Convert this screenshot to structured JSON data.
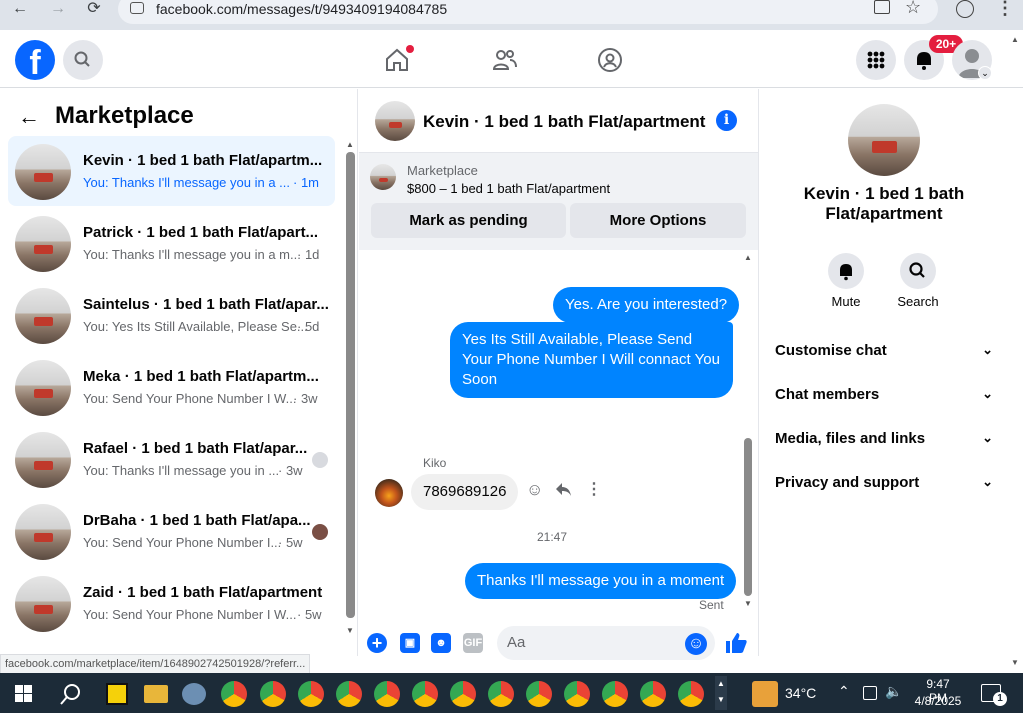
{
  "browser": {
    "url": "facebook.com/messages/t/9493409194084785"
  },
  "header": {
    "notifications_badge": "20+"
  },
  "sidebar": {
    "title": "Marketplace",
    "conversations": [
      {
        "name": "Kevin · 1 bed 1 bath Flat/apartm...",
        "preview": "You: Thanks I'll message you in a ...",
        "time": "· 1m"
      },
      {
        "name": "Patrick · 1 bed 1 bath Flat/apart...",
        "preview": "You: Thanks I'll message you in a m...",
        "time": "· 1d"
      },
      {
        "name": "Saintelus · 1 bed 1 bath Flat/apar...",
        "preview": "You: Yes Its Still Available, Please Se...",
        "time": "· 5d"
      },
      {
        "name": "Meka · 1 bed 1 bath Flat/apartm...",
        "preview": "You: Send Your Phone Number I W...",
        "time": "· 3w"
      },
      {
        "name": "Rafael · 1 bed 1 bath Flat/apar...",
        "preview": "You: Thanks I'll message you in ...",
        "time": "· 3w"
      },
      {
        "name": "DrBaha · 1 bed 1 bath Flat/apa...",
        "preview": "You: Send Your Phone Number I...",
        "time": "· 5w"
      },
      {
        "name": "Zaid · 1 bed 1 bath Flat/apartment",
        "preview": "You: Send Your Phone Number I W...",
        "time": "· 5w"
      }
    ],
    "status_url": "facebook.com/marketplace/item/1648902742501928/?referr..."
  },
  "chat": {
    "title": "Kevin · 1 bed 1 bath Flat/apartment",
    "listing_label": "Marketplace",
    "listing_desc": "$800 – 1 bed 1 bath Flat/apartment",
    "mark_pending": "Mark as pending",
    "more_options": "More Options",
    "messages": {
      "m1": "Yes. Are you interested?",
      "m2": "Yes Its Still Available, Please Send Your Phone Number I Will connact You Soon",
      "sender": "Kiko",
      "m3": "7869689126",
      "timestamp": "21:47",
      "m4": "Thanks I'll message you in a moment",
      "sent": "Sent"
    },
    "composer_placeholder": "Aa",
    "gif_label": "GIF"
  },
  "details": {
    "name": "Kevin · 1 bed 1 bath Flat/apartment",
    "mute": "Mute",
    "search": "Search",
    "sections": [
      "Customise chat",
      "Chat members",
      "Media, files and links",
      "Privacy and support"
    ]
  },
  "taskbar": {
    "temperature": "34°C",
    "time": "9:47 PM",
    "date": "4/8/2025",
    "notification_count": "1"
  }
}
